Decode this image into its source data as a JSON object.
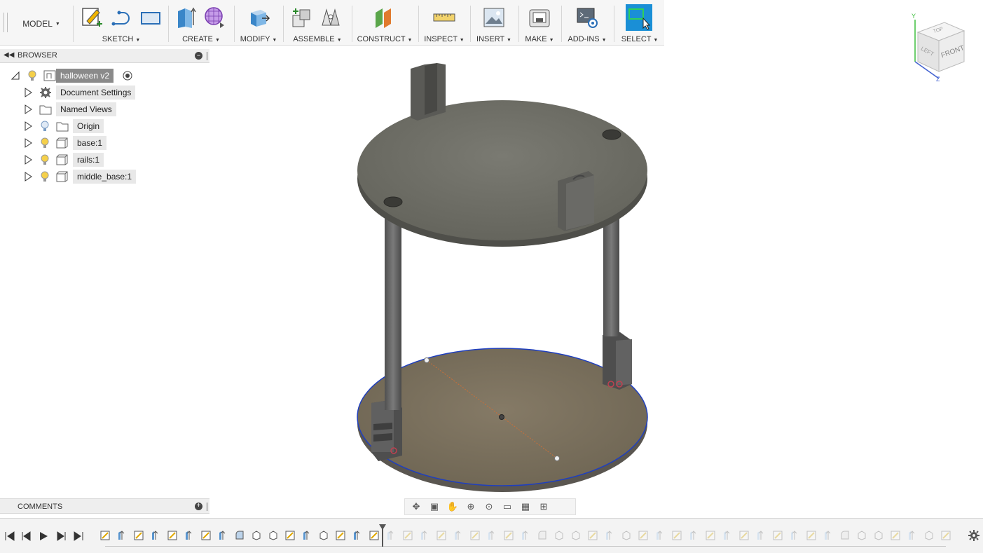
{
  "toolbar": {
    "mode_label": "MODEL",
    "groups": [
      {
        "label": "SKETCH"
      },
      {
        "label": "CREATE"
      },
      {
        "label": "MODIFY"
      },
      {
        "label": "ASSEMBLE"
      },
      {
        "label": "CONSTRUCT"
      },
      {
        "label": "INSPECT"
      },
      {
        "label": "INSERT"
      },
      {
        "label": "MAKE"
      },
      {
        "label": "ADD-INS"
      },
      {
        "label": "SELECT"
      }
    ],
    "select_color": "#1a8fd6"
  },
  "browser": {
    "title": "BROWSER",
    "root": {
      "label": "halloween v2"
    },
    "items": [
      {
        "label": "Document Settings",
        "icon": "gear-icon"
      },
      {
        "label": "Named Views",
        "icon": "folder-icon"
      },
      {
        "label": "Origin",
        "icon": "folder-icon"
      },
      {
        "label": "base:1",
        "icon": "component-icon"
      },
      {
        "label": "rails:1",
        "icon": "component-icon"
      },
      {
        "label": "middle_base:1",
        "icon": "component-icon"
      }
    ]
  },
  "comments": {
    "title": "COMMENTS"
  },
  "viewcube": {
    "top": "TOP",
    "front": "FRONT",
    "left": "LEFT",
    "axis_y": "Y",
    "axis_z": "Z"
  },
  "timeline": {
    "feature_count": 51,
    "marker_index": 17
  }
}
